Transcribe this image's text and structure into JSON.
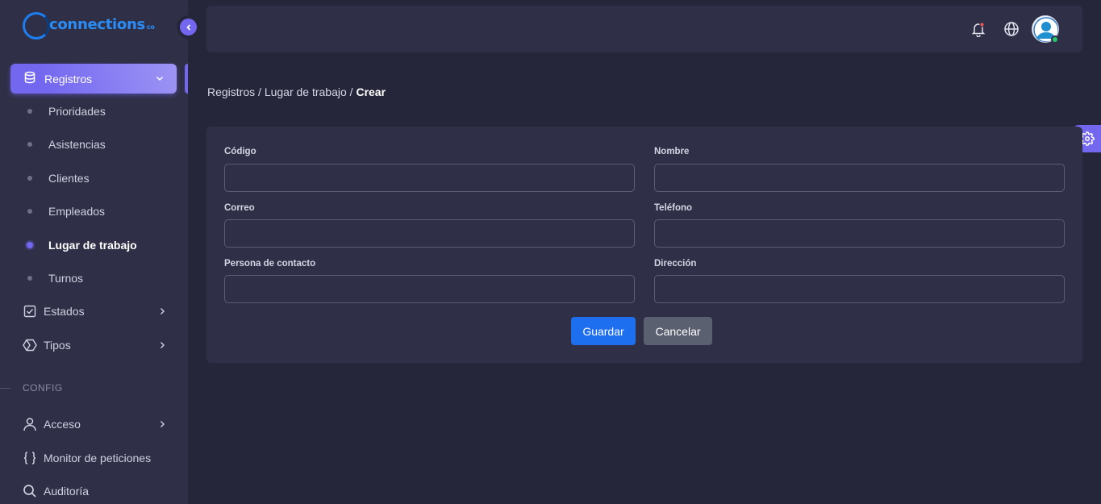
{
  "brand": {
    "name": "connections",
    "suffix": "co"
  },
  "sidebar": {
    "active_group": {
      "label": "Registros",
      "icon": "database-icon"
    },
    "sub_items": [
      {
        "label": "Prioridades"
      },
      {
        "label": "Asistencias"
      },
      {
        "label": "Clientes"
      },
      {
        "label": "Empleados"
      },
      {
        "label": "Lugar de trabajo",
        "current": true
      },
      {
        "label": "Turnos"
      }
    ],
    "groups": [
      {
        "label": "Estados",
        "icon": "checkbox-icon"
      },
      {
        "label": "Tipos",
        "icon": "hexagon-icon"
      }
    ],
    "section_config": "CONFIG",
    "config_items": [
      {
        "label": "Acceso",
        "icon": "user-icon"
      },
      {
        "label": "Monitor de peticiones",
        "icon": "braces-icon"
      },
      {
        "label": "Auditoría",
        "icon": "search-icon"
      }
    ]
  },
  "breadcrumb": {
    "part1": "Registros",
    "sep1": " / ",
    "part2": "Lugar de trabajo",
    "sep2": " / ",
    "current": "Crear"
  },
  "form": {
    "fields": [
      {
        "label": "Código",
        "value": ""
      },
      {
        "label": "Nombre",
        "value": ""
      },
      {
        "label": "Correo",
        "value": ""
      },
      {
        "label": "Teléfono",
        "value": ""
      },
      {
        "label": "Persona de contacto",
        "value": ""
      },
      {
        "label": "Dirección",
        "value": ""
      }
    ],
    "save_label": "Guardar",
    "cancel_label": "Cancelar"
  },
  "colors": {
    "accent": "#7367f0",
    "primary_button": "#1e6ff0",
    "secondary_button": "#5a6070",
    "status_online": "#28c76f",
    "notification_dot": "#ea5455"
  }
}
